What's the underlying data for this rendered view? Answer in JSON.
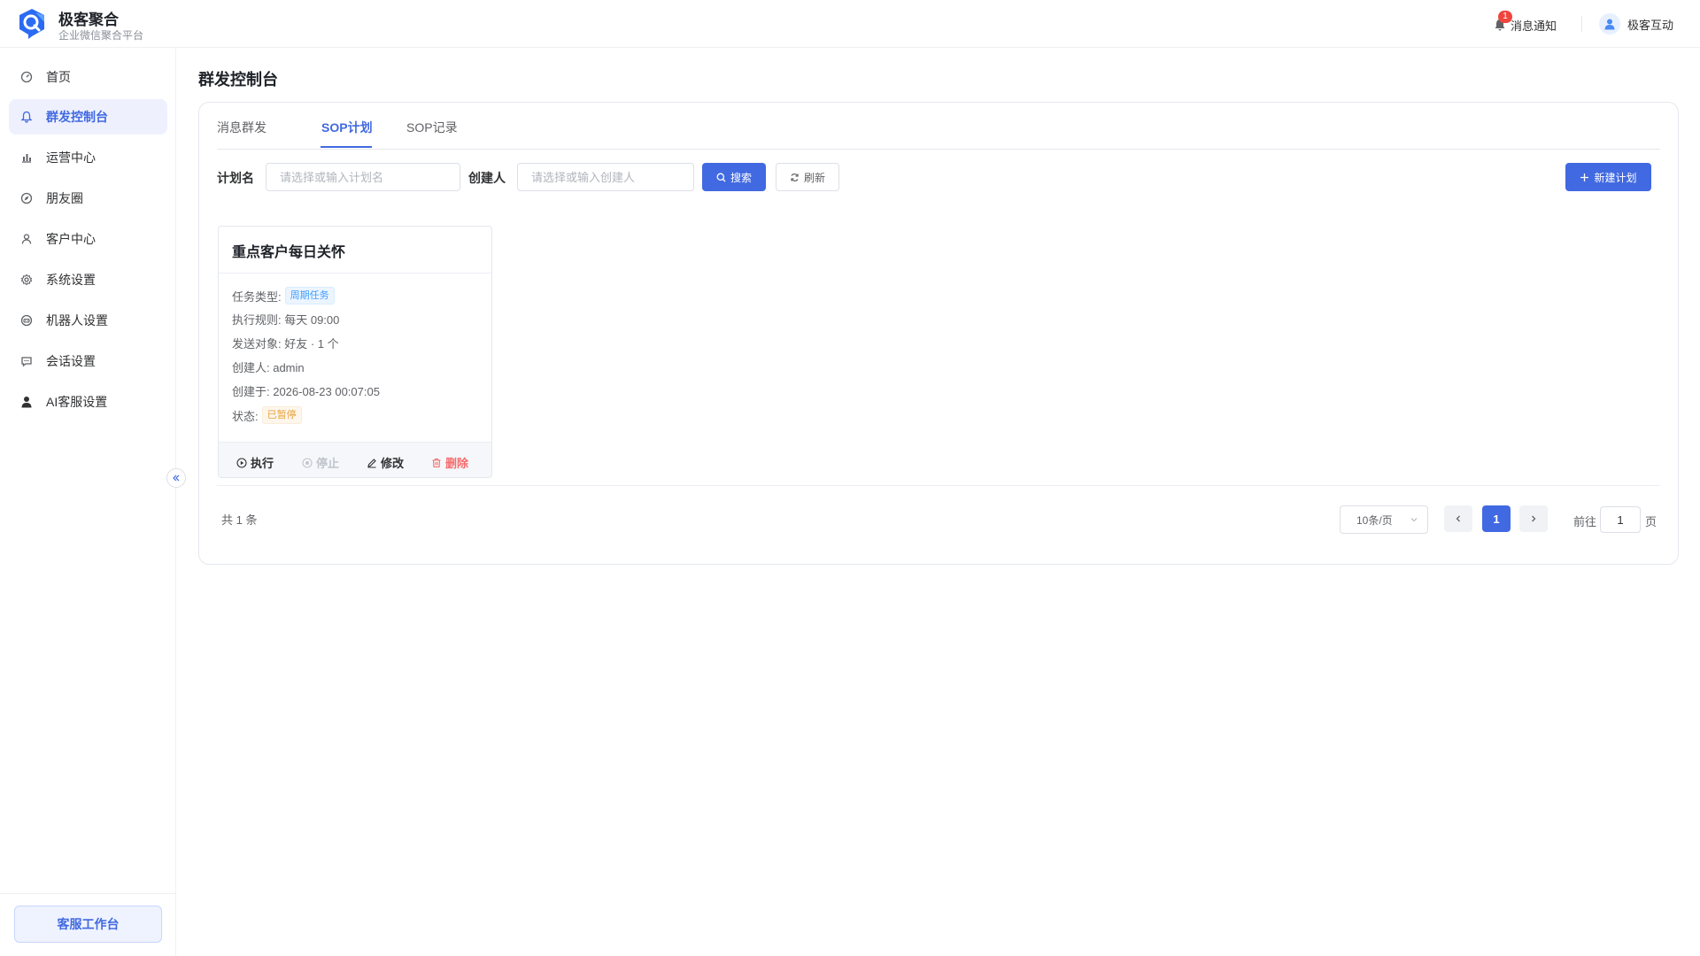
{
  "header": {
    "brand_name": "极客聚合",
    "brand_sub": "企业微信聚合平台",
    "notif_count": "1",
    "notif_label": "消息通知",
    "user_name": "极客互动"
  },
  "sidebar": {
    "items": [
      {
        "label": "首页",
        "icon": "dashboard-icon"
      },
      {
        "label": "群发控制台",
        "icon": "bell-icon",
        "active": true
      },
      {
        "label": "运营中心",
        "icon": "bar-chart-icon"
      },
      {
        "label": "朋友圈",
        "icon": "compass-icon"
      },
      {
        "label": "客户中心",
        "icon": "user-icon"
      },
      {
        "label": "系统设置",
        "icon": "gear-icon"
      },
      {
        "label": "机器人设置",
        "icon": "robot-icon"
      },
      {
        "label": "会话设置",
        "icon": "chat-icon"
      },
      {
        "label": "AI客服设置",
        "icon": "person-icon"
      }
    ],
    "workbench_label": "客服工作台"
  },
  "main": {
    "page_title": "群发控制台",
    "tabs": [
      {
        "label": "消息群发",
        "active": false
      },
      {
        "label": "SOP计划",
        "active": true
      },
      {
        "label": "SOP记录",
        "active": false
      }
    ],
    "filters": {
      "plan_label": "计划名",
      "plan_placeholder": "请选择或输入计划名",
      "plan_value": "",
      "creator_label": "创建人",
      "creator_placeholder": "请选择或输入创建人",
      "creator_value": "",
      "search_label": "搜索",
      "refresh_label": "刷新",
      "new_label": "新建计划"
    },
    "card": {
      "title": "重点客户每日关怀",
      "type_label": "任务类型:",
      "type_tag": "周期任务",
      "rule": "执行规则: 每天 09:00",
      "target": "发送对象: 好友 · 1 个",
      "creator": "创建人: admin",
      "created": "创建于: 2026-08-23 00:07:05",
      "status_label": "状态:",
      "status_tag": "已暂停",
      "actions": {
        "run": "执行",
        "stop": "停止",
        "edit": "修改",
        "delete": "删除"
      }
    },
    "pagination": {
      "total": "共 1 条",
      "page_size": "10条/页",
      "current_page": "1",
      "goto_label": "前往",
      "goto_value": "1",
      "page_unit": "页"
    }
  },
  "colors": {
    "primary": "#4169e1",
    "danger": "#f56c6c",
    "disabled": "#c0c4cc",
    "tag_blue": "#409eff",
    "tag_yellow": "#e6a23c"
  }
}
